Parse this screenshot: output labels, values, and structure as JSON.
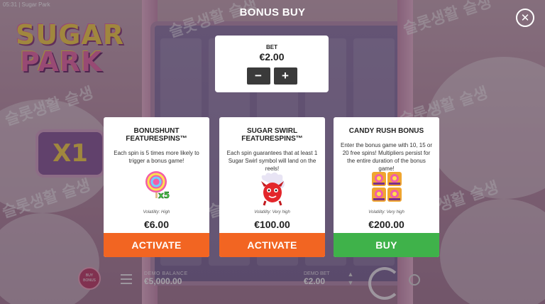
{
  "app": {
    "title": "05:31 | Sugar Park"
  },
  "background": {
    "logo_line1": "SUGAR",
    "logo_line2": "PARK",
    "multiplier": "X1",
    "watermark": "슬롯생활 슬생",
    "chip_label": "BUY BONUS",
    "balance_label": "DEMO BALANCE",
    "balance_value": "€5,000.00",
    "bet_label": "DEMO BET",
    "bet_value": "€2.00"
  },
  "modal": {
    "title": "BONUS BUY",
    "close_icon": "close-icon",
    "bet": {
      "label": "BET",
      "value": "€2.00",
      "decrease": "−",
      "increase": "+"
    },
    "cards": [
      {
        "title": "BONUSHUNT FEATURESPINS™",
        "description": "Each spin is 5 times more likely to trigger a bonus game!",
        "icon": "lollipop-x5-icon",
        "volatility": "Volatility: High",
        "price": "€6.00",
        "button": "ACTIVATE",
        "button_color": "#f26522"
      },
      {
        "title": "SUGAR SWIRL FEATURESPINS™",
        "description": "Each spin guarantees that at least 1 Sugar Swirl symbol will land on the reels!",
        "icon": "sugar-swirl-monster-icon",
        "volatility": "Volatility: Very high",
        "price": "€100.00",
        "button": "ACTIVATE",
        "button_color": "#f26522"
      },
      {
        "title": "CANDY RUSH BONUS",
        "description": "Enter the bonus game with 10, 15 or 20 free spins! Multipliers persist for the entire duration of the bonus game!",
        "icon": "scatter-symbols-icon",
        "volatility": "Volatility: Very high",
        "price": "€200.00",
        "button": "BUY",
        "button_color": "#3fb24a"
      }
    ]
  }
}
